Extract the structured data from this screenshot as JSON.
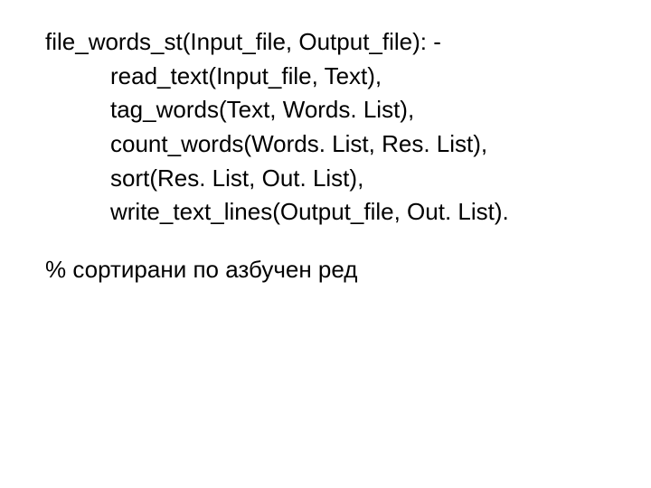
{
  "code": {
    "head": "file_words_st(Input_file, Output_file): -",
    "body": [
      "read_text(Input_file, Text),",
      "tag_words(Text, Words. List),",
      "count_words(Words. List, Res. List),",
      "sort(Res. List, Out. List),",
      "write_text_lines(Output_file, Out. List)."
    ]
  },
  "comment": "% сортирани по азбучен ред"
}
